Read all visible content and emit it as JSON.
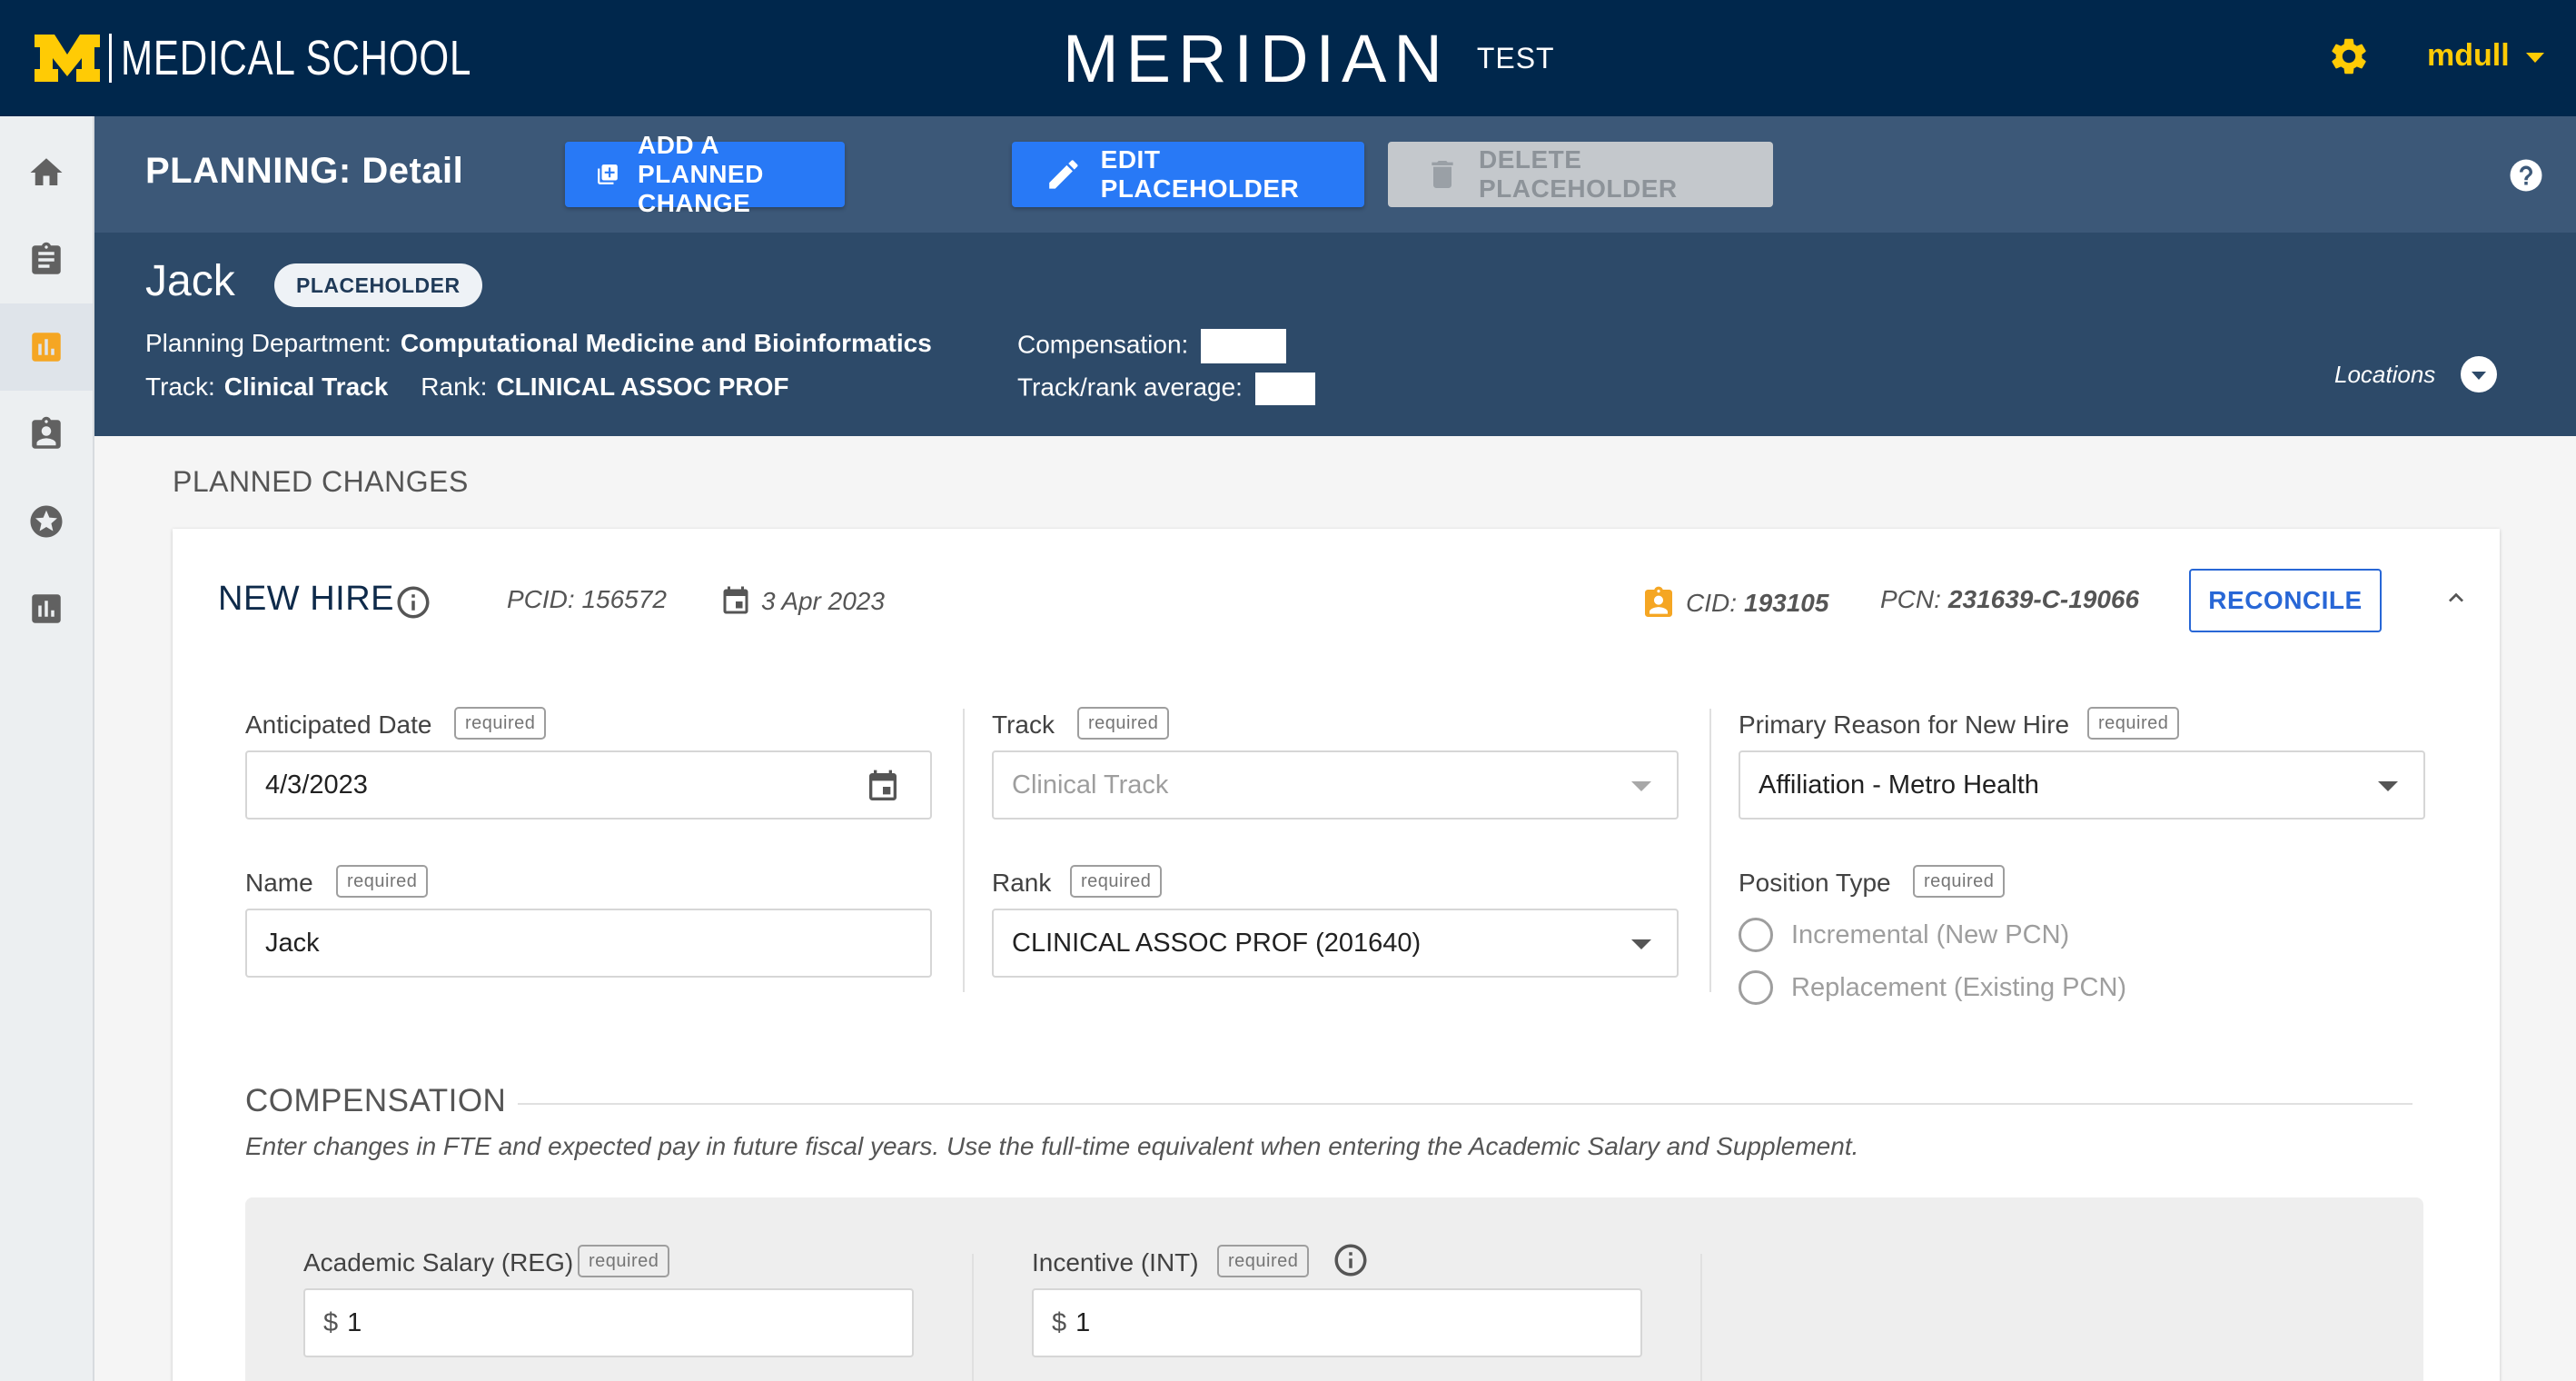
{
  "topbar": {
    "brand_text": "MEDICAL SCHOOL",
    "app_name": "MERIDIAN",
    "environment": "TEST",
    "username": "mdull",
    "colors": {
      "bg": "#00274c",
      "accent": "#ffcb05"
    }
  },
  "sidebar": {
    "items": [
      {
        "icon": "home-icon"
      },
      {
        "icon": "clipboard-icon"
      },
      {
        "icon": "planning-chart-icon",
        "active": true
      },
      {
        "icon": "badge-icon"
      },
      {
        "icon": "star-icon"
      },
      {
        "icon": "report-chart-icon"
      }
    ]
  },
  "header": {
    "title": "PLANNING: Detail",
    "add_change_label": "ADD A PLANNED CHANGE",
    "edit_placeholder_label": "EDIT PLACEHOLDER",
    "delete_placeholder_label": "DELETE PLACEHOLDER"
  },
  "person": {
    "name": "Jack",
    "badge": "PLACEHOLDER",
    "planning_department_label": "Planning Department:",
    "planning_department": "Computational Medicine and Bioinformatics",
    "track_label": "Track:",
    "track": "Clinical Track",
    "rank_label": "Rank:",
    "rank": "CLINICAL ASSOC PROF",
    "compensation_label": "Compensation:",
    "track_rank_average_label": "Track/rank average:",
    "locations_label": "Locations"
  },
  "planned_changes": {
    "section_title": "PLANNED CHANGES",
    "card": {
      "type": "NEW HIRE",
      "pcid": "PCID: 156572",
      "date": "3 Apr 2023",
      "cid_label": "CID:",
      "cid": "193105",
      "pcn_label": "PCN:",
      "pcn": "231639-C-19066",
      "reconcile_label": "RECONCILE",
      "required_text": "required",
      "fields": {
        "anticipated_date": {
          "label": "Anticipated Date",
          "value": "4/3/2023"
        },
        "name": {
          "label": "Name",
          "value": "Jack"
        },
        "track": {
          "label": "Track",
          "value": "Clinical Track"
        },
        "rank": {
          "label": "Rank",
          "value": "CLINICAL ASSOC PROF (201640)"
        },
        "primary_reason": {
          "label": "Primary Reason for New Hire",
          "value": "Affiliation - Metro Health"
        },
        "position_type": {
          "label": "Position Type",
          "options": [
            "Incremental (New PCN)",
            "Replacement (Existing PCN)"
          ]
        }
      },
      "compensation": {
        "title": "COMPENSATION",
        "description": "Enter changes in FTE and expected pay in future fiscal years. Use the full-time equivalent when entering the Academic Salary and Supplement.",
        "academic_salary": {
          "label": "Academic Salary (REG)",
          "currency": "$",
          "value": "1"
        },
        "incentive": {
          "label": "Incentive (INT)",
          "currency": "$",
          "value": "1"
        }
      }
    }
  },
  "colors": {
    "primary_button": "#2879f6",
    "header_band": "#3c5878",
    "info_band": "#2d4a69",
    "cid_badge": "#f5a623"
  }
}
